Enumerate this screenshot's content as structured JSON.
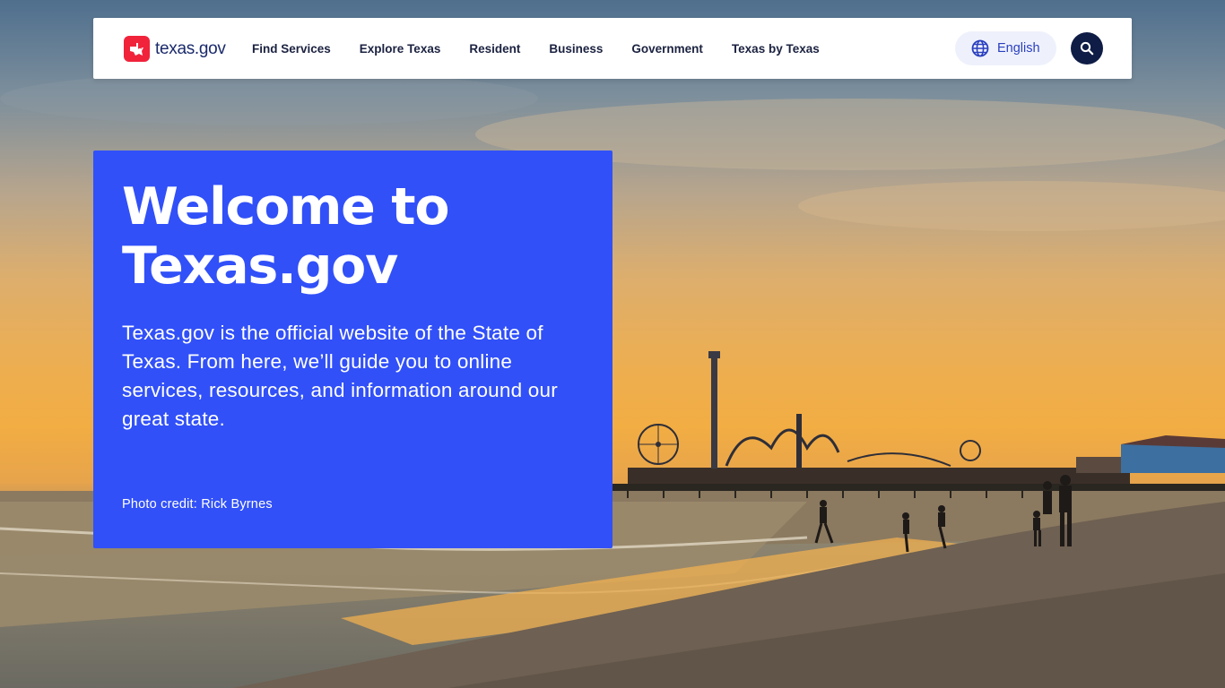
{
  "nav": {
    "logo_text": "texas.gov",
    "links": [
      "Find Services",
      "Explore Texas",
      "Resident",
      "Business",
      "Government",
      "Texas by Texas"
    ],
    "language_label": "English"
  },
  "hero": {
    "title": "Welcome to Texas.gov",
    "description": "Texas.gov is the official website of the State of Texas. From here, we’ll guide you to online services, resources, and information around our great state.",
    "photo_credit": "Photo credit: Rick Byrnes"
  },
  "colors": {
    "brand_red": "#f0233b",
    "card_blue": "#3150f8",
    "nav_dark": "#0e1c46",
    "link_blue": "#2a3fbf"
  },
  "icons": [
    "texas-star-icon",
    "globe-icon",
    "search-icon"
  ]
}
